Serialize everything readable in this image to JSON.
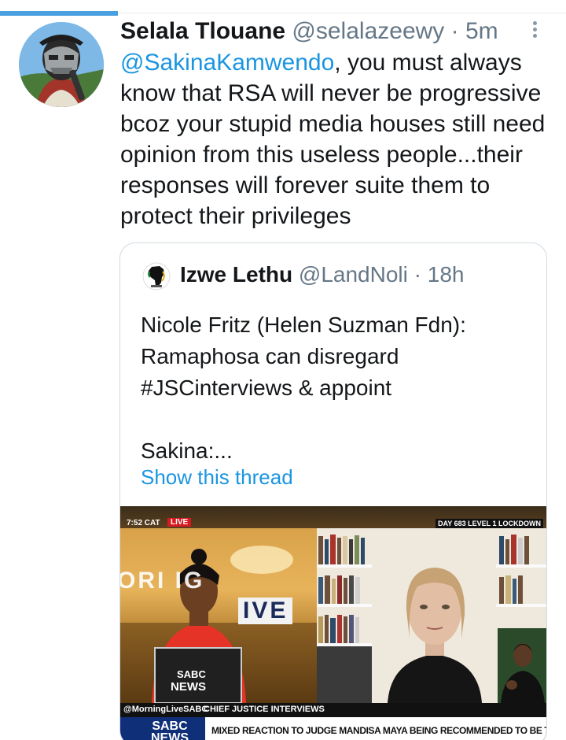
{
  "tweet": {
    "author_name": "Selala Tlouane",
    "handle": "@selalazeewy",
    "separator": "·",
    "time": "5m",
    "mention": "@SakinaKamwendo",
    "text_lines": [
      ", you must always",
      "know that RSA will never be progressive",
      "bcoz your stupid media houses still need",
      "opinion from this useless people...their",
      "responses will forever suite them to",
      "protect their privileges"
    ],
    "avatar_icon": "user-avatar",
    "more_icon": "vertical-dots-icon"
  },
  "quote": {
    "author_name": "Izwe Lethu",
    "handle": "@LandNoli",
    "separator": "·",
    "time": "18h",
    "text_lines": [
      "Nicole Fritz (Helen Suzman Fdn):",
      "Ramaphosa can disregard",
      "#JSCinterviews & appoint",
      "",
      "Sakina:..."
    ],
    "show_thread": "Show this thread",
    "logo_icon": "africa-map-icon"
  },
  "video": {
    "clock": "7:52 CAT",
    "live": "LIVE",
    "lockdown": "DAY 683 LEVEL 1 LOCKDOWN",
    "studio_text_1": "ORI  IG",
    "studio_text_2": "IVE",
    "handle": "@MorningLiveSABC",
    "segment": "CHIEF JUSTICE INTERVIEWS",
    "logo_text": "SABC NEWS",
    "headline": "MIXED REACTION TO JUDGE MANDISA MAYA BEING RECOMMENDED TO BE THE NEXT CHIEF JUSTICE"
  },
  "colors": {
    "link": "#1b95e0",
    "muted": "#657786",
    "accent": "#4a9fe0"
  }
}
